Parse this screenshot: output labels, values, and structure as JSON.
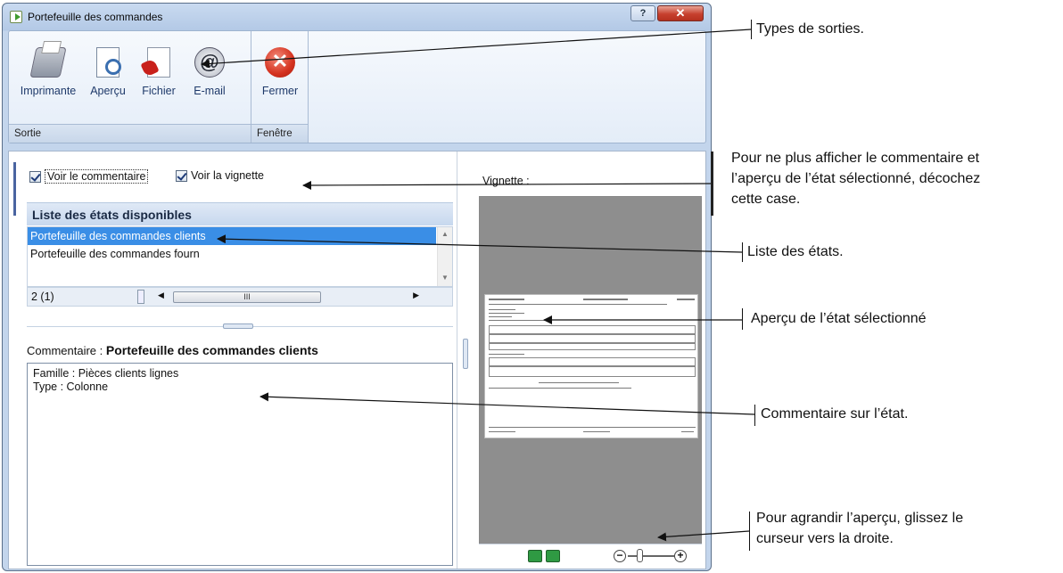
{
  "window": {
    "title": "Portefeuille des commandes",
    "help_glyph": "?",
    "close_glyph": "✕"
  },
  "ribbon": {
    "groups": [
      {
        "label": "Sortie"
      },
      {
        "label": "Fenêtre"
      }
    ],
    "buttons": {
      "printer": {
        "label": "Imprimante",
        "icon": "printer-icon"
      },
      "preview": {
        "label": "Aperçu",
        "icon": "preview-icon"
      },
      "file": {
        "label": "Fichier",
        "icon": "pdf-file-icon"
      },
      "email": {
        "label": "E-mail",
        "icon": "email-icon",
        "glyph": "@"
      },
      "close": {
        "label": "Fermer",
        "icon": "close-icon",
        "glyph": "✕"
      }
    }
  },
  "options": {
    "show_comment": {
      "label": "Voir le commentaire",
      "checked": true
    },
    "show_thumbnail": {
      "label": "Voir la vignette",
      "checked": true
    }
  },
  "list": {
    "header": "Liste des états disponibles",
    "rows": [
      {
        "label": "Portefeuille des commandes clients",
        "selected": true
      },
      {
        "label": "Portefeuille des commandes fourn",
        "selected": false
      }
    ],
    "status": "2 (1)",
    "scroll_thumb": "III"
  },
  "comment": {
    "label": "Commentaire :",
    "title": "Portefeuille des commandes clients",
    "lines": [
      "Famille : Pièces clients lignes",
      "Type : Colonne"
    ]
  },
  "thumbnail": {
    "label": "Vignette :",
    "zoom_out": "−",
    "zoom_in": "+"
  },
  "callouts": {
    "types": "Types de sorties.",
    "hide_line1": "Pour ne plus afficher le commentaire et",
    "hide_line2": "l’aperçu de l’état sélectionné, décochez",
    "hide_line3": "cette case.",
    "list": "Liste des états.",
    "preview": "Aperçu de l’état sélectionné",
    "comment": "Commentaire sur l’état.",
    "enlarge_line1": "Pour agrandir l’aperçu, glissez le",
    "enlarge_line2": "curseur vers la droite."
  }
}
